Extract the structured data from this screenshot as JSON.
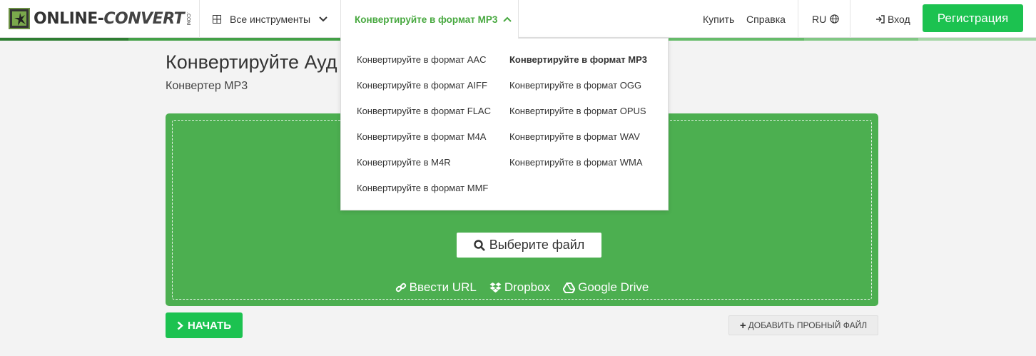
{
  "header": {
    "logo": {
      "main": "ONLINE-",
      "alt": "CONVERT",
      "dom": ".COM"
    },
    "tools_label": "Все инструменты",
    "active_menu": "Конвертируйте в формат MP3",
    "buy": "Купить",
    "help": "Справка",
    "lang": "RU",
    "login": "Вход",
    "register": "Регистрация"
  },
  "dropdown": {
    "col1": [
      "Конвертируйте в формат AAC",
      "Конвертируйте в формат AIFF",
      "Конвертируйте в формат FLAC",
      "Конвертируйте в формат M4A",
      "Конвертируйте в M4R",
      "Конвертируйте в формат MMF"
    ],
    "col2": [
      "Конвертируйте в формат MP3",
      "Конвертируйте в формат OGG",
      "Конвертируйте в формат OPUS",
      "Конвертируйте в формат WAV",
      "Конвертируйте в формат WMA"
    ]
  },
  "page": {
    "title": "Конвертируйте Ауд",
    "subtitle": "Конвертер MP3"
  },
  "upload": {
    "choose": "Выберите файл",
    "url": "Ввести URL",
    "dropbox": "Dropbox",
    "gdrive": "Google Drive"
  },
  "actions": {
    "start": "НАЧАТЬ",
    "sample": "ДОБАВИТЬ ПРОБНЫЙ ФАЙЛ"
  },
  "colors": {
    "brand_green": "#1cc250",
    "upload_green": "#4caf50",
    "active_text": "#47a83f"
  }
}
